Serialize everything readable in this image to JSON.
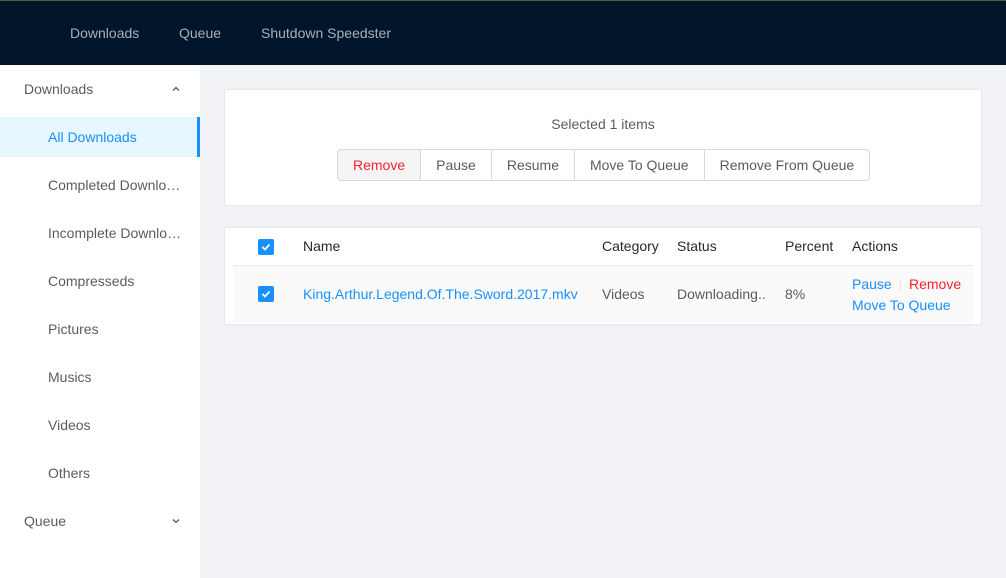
{
  "topnav": {
    "items": [
      "Downloads",
      "Queue",
      "Shutdown Speedster"
    ]
  },
  "sidebar": {
    "downloads_title": "Downloads",
    "downloads_expanded": true,
    "items": [
      "All Downloads",
      "Completed Downloads",
      "Incomplete Downloads",
      "Compresseds",
      "Pictures",
      "Musics",
      "Videos",
      "Others"
    ],
    "selected": "All Downloads",
    "queue_title": "Queue",
    "queue_expanded": false
  },
  "toolbar": {
    "selection_text": "Selected 1 items",
    "buttons": [
      "Remove",
      "Pause",
      "Resume",
      "Move To Queue",
      "Remove From Queue"
    ]
  },
  "table": {
    "columns": [
      "Name",
      "Category",
      "Status",
      "Percent",
      "Actions"
    ],
    "header_checked": true,
    "rows": [
      {
        "checked": true,
        "name": "King.Arthur.Legend.Of.The.Sword.2017.mkv",
        "category": "Videos",
        "status": "Downloading..",
        "percent": "8%",
        "actions": {
          "pause": "Pause",
          "remove": "Remove",
          "move": "Move To Queue"
        }
      }
    ]
  },
  "colors": {
    "topbar": "#001529",
    "primary": "#1890ff",
    "danger": "#f5222d",
    "selected_bg": "#e6f7ff"
  }
}
